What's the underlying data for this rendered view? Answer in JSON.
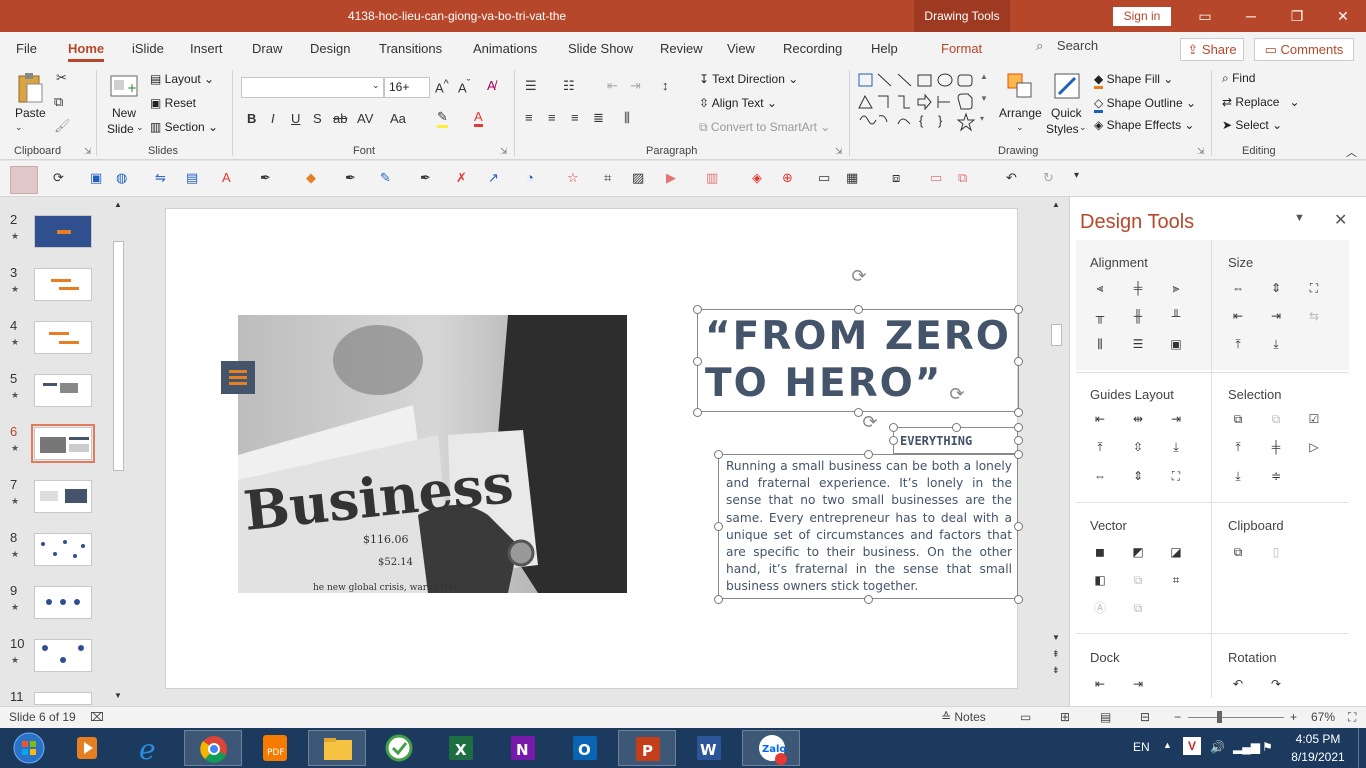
{
  "window": {
    "title": "4138-hoc-lieu-can-giong-va-bo-tri-vat-the",
    "context_tab": "Drawing Tools",
    "sign_in": "Sign in"
  },
  "tabs": [
    {
      "label": "File"
    },
    {
      "label": "Home"
    },
    {
      "label": "iSlide"
    },
    {
      "label": "Insert"
    },
    {
      "label": "Draw"
    },
    {
      "label": "Design"
    },
    {
      "label": "Transitions"
    },
    {
      "label": "Animations"
    },
    {
      "label": "Slide Show"
    },
    {
      "label": "Review"
    },
    {
      "label": "View"
    },
    {
      "label": "Recording"
    },
    {
      "label": "Help"
    },
    {
      "label": "Format"
    }
  ],
  "search": {
    "label": "Search"
  },
  "share": {
    "label": "Share"
  },
  "comments": {
    "label": "Comments"
  },
  "ribbon": {
    "clipboard": {
      "label": "Clipboard",
      "paste": "Paste"
    },
    "slides": {
      "label": "Slides",
      "new_slide_1": "New",
      "new_slide_2": "Slide",
      "layout": "Layout",
      "reset": "Reset",
      "section": "Section"
    },
    "font": {
      "label": "Font",
      "name": "",
      "size": "16+"
    },
    "paragraph": {
      "label": "Paragraph",
      "text_direction": "Text Direction",
      "align_text": "Align Text",
      "convert_smartart": "Convert to SmartArt"
    },
    "drawing": {
      "label": "Drawing",
      "arrange": "Arrange",
      "quick_styles_1": "Quick",
      "quick_styles_2": "Styles",
      "shape_fill": "Shape Fill",
      "shape_outline": "Shape Outline",
      "shape_effects": "Shape Effects"
    },
    "editing": {
      "label": "Editing",
      "find": "Find",
      "replace": "Replace",
      "select": "Select"
    }
  },
  "slides_panel": {
    "items": [
      {
        "num": "2"
      },
      {
        "num": "3"
      },
      {
        "num": "4"
      },
      {
        "num": "5"
      },
      {
        "num": "6"
      },
      {
        "num": "7"
      },
      {
        "num": "8"
      },
      {
        "num": "9"
      },
      {
        "num": "10"
      },
      {
        "num": "11"
      }
    ],
    "star": "★"
  },
  "slide": {
    "headline_1": "“FROM ZERO",
    "headline_2": "TO HERO”",
    "subtitle": "EVERYTHING",
    "body": "Running a small business can be both a lonely and fraternal experience. It’s lonely in the sense that no two small businesses are the same. Every entrepreneur has to deal with a unique set of circumstances and factors that are specific to their business. On the other hand, it’s fraternal in the sense that small business owners stick together.",
    "photo_word": "Business",
    "photo_price_1": "$116.06",
    "photo_price_2": "$52.14",
    "photo_headline": "he new global crisis, warns IMF"
  },
  "design_tools": {
    "title": "Design Tools",
    "sections": {
      "alignment": "Alignment",
      "size": "Size",
      "guides_layout": "Guides Layout",
      "selection": "Selection",
      "vector": "Vector",
      "clipboard": "Clipboard",
      "dock": "Dock",
      "rotation": "Rotation"
    }
  },
  "status": {
    "slide_info": "Slide 6 of 19",
    "notes": "Notes",
    "zoom": "67%"
  },
  "taskbar": {
    "lang": "EN",
    "time": "4:05 PM",
    "date": "8/19/2021"
  },
  "colors": {
    "accent": "#b7472a",
    "slide_text": "#44546a",
    "taskbar": "#1c3a5e"
  }
}
